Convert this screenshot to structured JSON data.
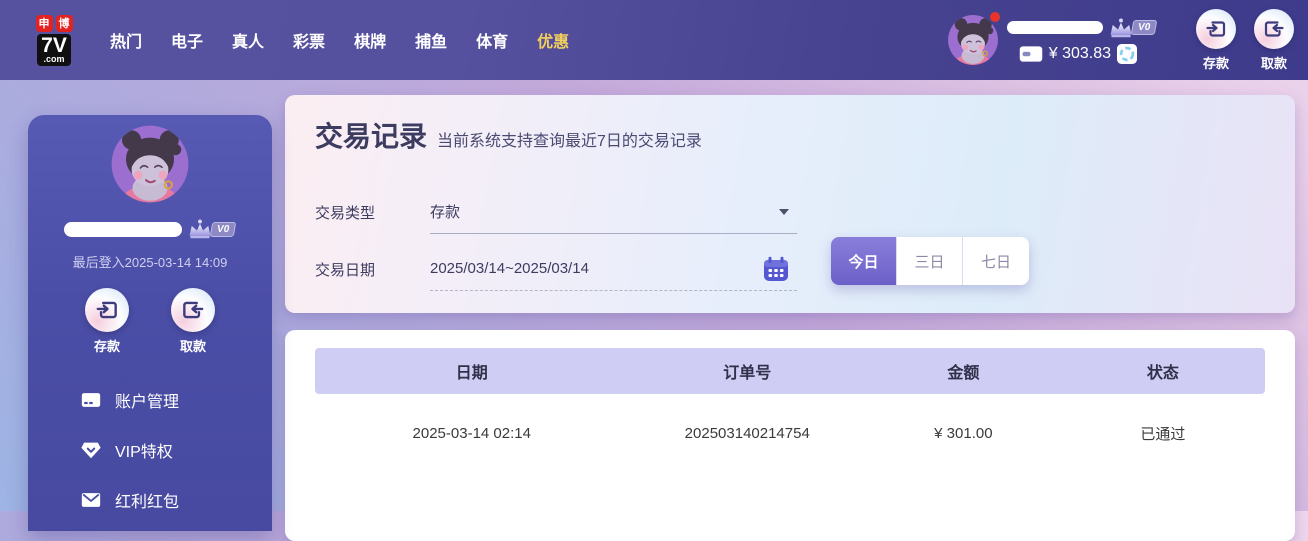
{
  "topbar": {
    "logo": {
      "badge1": "申",
      "badge2": "博",
      "main": "7V",
      "suffix": ".com"
    },
    "nav": [
      {
        "label": "热门"
      },
      {
        "label": "电子"
      },
      {
        "label": "真人"
      },
      {
        "label": "彩票"
      },
      {
        "label": "棋牌"
      },
      {
        "label": "捕鱼"
      },
      {
        "label": "体育"
      },
      {
        "label": "优惠",
        "highlight": true
      }
    ],
    "user": {
      "vip": "V0",
      "balance": "¥ 303.83"
    },
    "actions": [
      {
        "label": "存款"
      },
      {
        "label": "取款"
      }
    ]
  },
  "sidebar": {
    "vip": "V0",
    "last_login": "最后登入2025-03-14 14:09",
    "actions": [
      {
        "label": "存款"
      },
      {
        "label": "取款"
      }
    ],
    "menu": [
      {
        "label": "账户管理",
        "icon": "card-icon"
      },
      {
        "label": "VIP特权",
        "icon": "vip-gem-icon"
      },
      {
        "label": "红利红包",
        "icon": "envelope-icon"
      }
    ]
  },
  "main": {
    "title": "交易记录",
    "subtitle": "当前系统支持查询最近7日的交易记录",
    "filters": {
      "type_label": "交易类型",
      "type_value": "存款",
      "date_label": "交易日期",
      "date_value": "2025/03/14~2025/03/14"
    },
    "range_tabs": [
      {
        "label": "今日",
        "active": true
      },
      {
        "label": "三日",
        "active": false
      },
      {
        "label": "七日",
        "active": false
      }
    ],
    "table": {
      "headers": [
        "日期",
        "订单号",
        "金额",
        "状态"
      ],
      "rows": [
        [
          "2025-03-14 02:14",
          "202503140214754",
          "¥ 301.00",
          "已通过"
        ]
      ]
    }
  },
  "colors": {
    "topbar_gradient_left": "#6a5fae",
    "topbar_gradient_right": "#3e3b8c",
    "nav_highlight": "#f2cf5c",
    "logo_badge_red": "#e32222",
    "sidebar_bg": "#4b4ea6",
    "active_tab_purple": "#6c60c8",
    "calendar_icon_purple": "#5457d0",
    "table_header_bg": "#cfcdf3",
    "refresh_icon_blue": "#8ccef2",
    "notification_dot_red": "#e8352c"
  }
}
